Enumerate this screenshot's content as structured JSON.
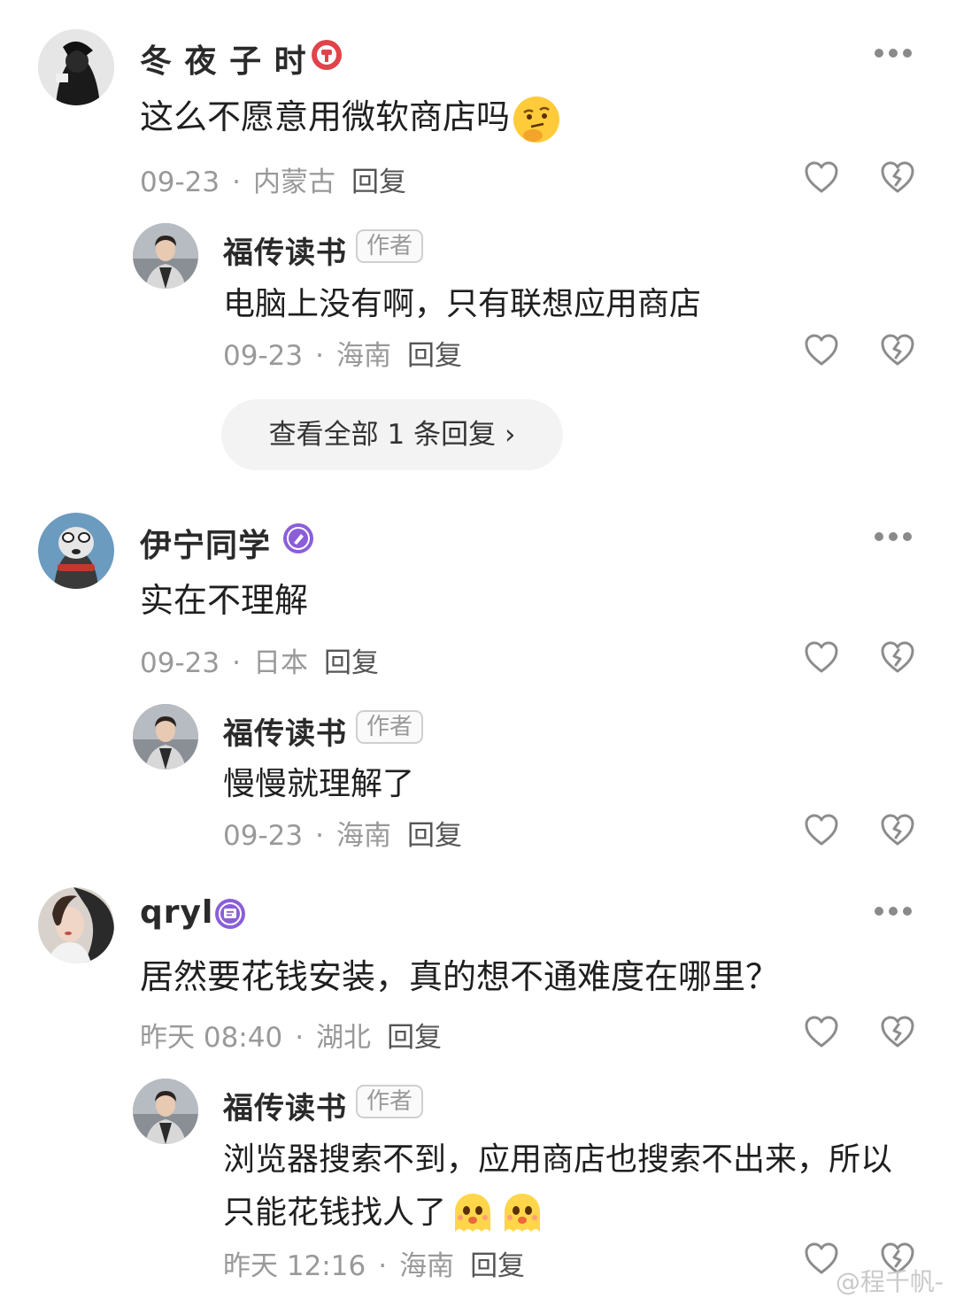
{
  "comments": [
    {
      "name": "冬 夜 子 时",
      "text": "这么不愿意用微软商店吗",
      "date": "09-23",
      "location": "内蒙古",
      "reply_label": "回复",
      "badge_icon": "red-badge-icon",
      "reply": {
        "name": "福传读书",
        "tag": "作者",
        "text": "电脑上没有啊，只有联想应用商店",
        "date": "09-23",
        "location": "海南",
        "reply_label": "回复"
      },
      "view_all": "查看全部 1 条回复 ›"
    },
    {
      "name": "伊宁同学",
      "text": "实在不理解",
      "date": "09-23",
      "location": "日本",
      "reply_label": "回复",
      "badge_icon": "purple-pen-badge-icon",
      "reply": {
        "name": "福传读书",
        "tag": "作者",
        "text": "慢慢就理解了",
        "date": "09-23",
        "location": "海南",
        "reply_label": "回复"
      }
    },
    {
      "name": "qryl",
      "text": "居然要花钱安装，真的想不通难度在哪里？",
      "date": "昨天 08:40",
      "location": "湖北",
      "reply_label": "回复",
      "badge_icon": "purple-chat-badge-icon",
      "reply": {
        "name": "福传读书",
        "tag": "作者",
        "text_line1": "浏览器搜索不到，应用商店也搜索不出来，所以",
        "text_line2": "只能花钱找人了",
        "date": "昨天 12:16",
        "location": "海南",
        "reply_label": "回复"
      }
    }
  ],
  "watermark": "@程千帆-",
  "colors": {
    "meta": "#999999",
    "badge_red": "#e0434a",
    "badge_purple": "#8b5ed8"
  }
}
